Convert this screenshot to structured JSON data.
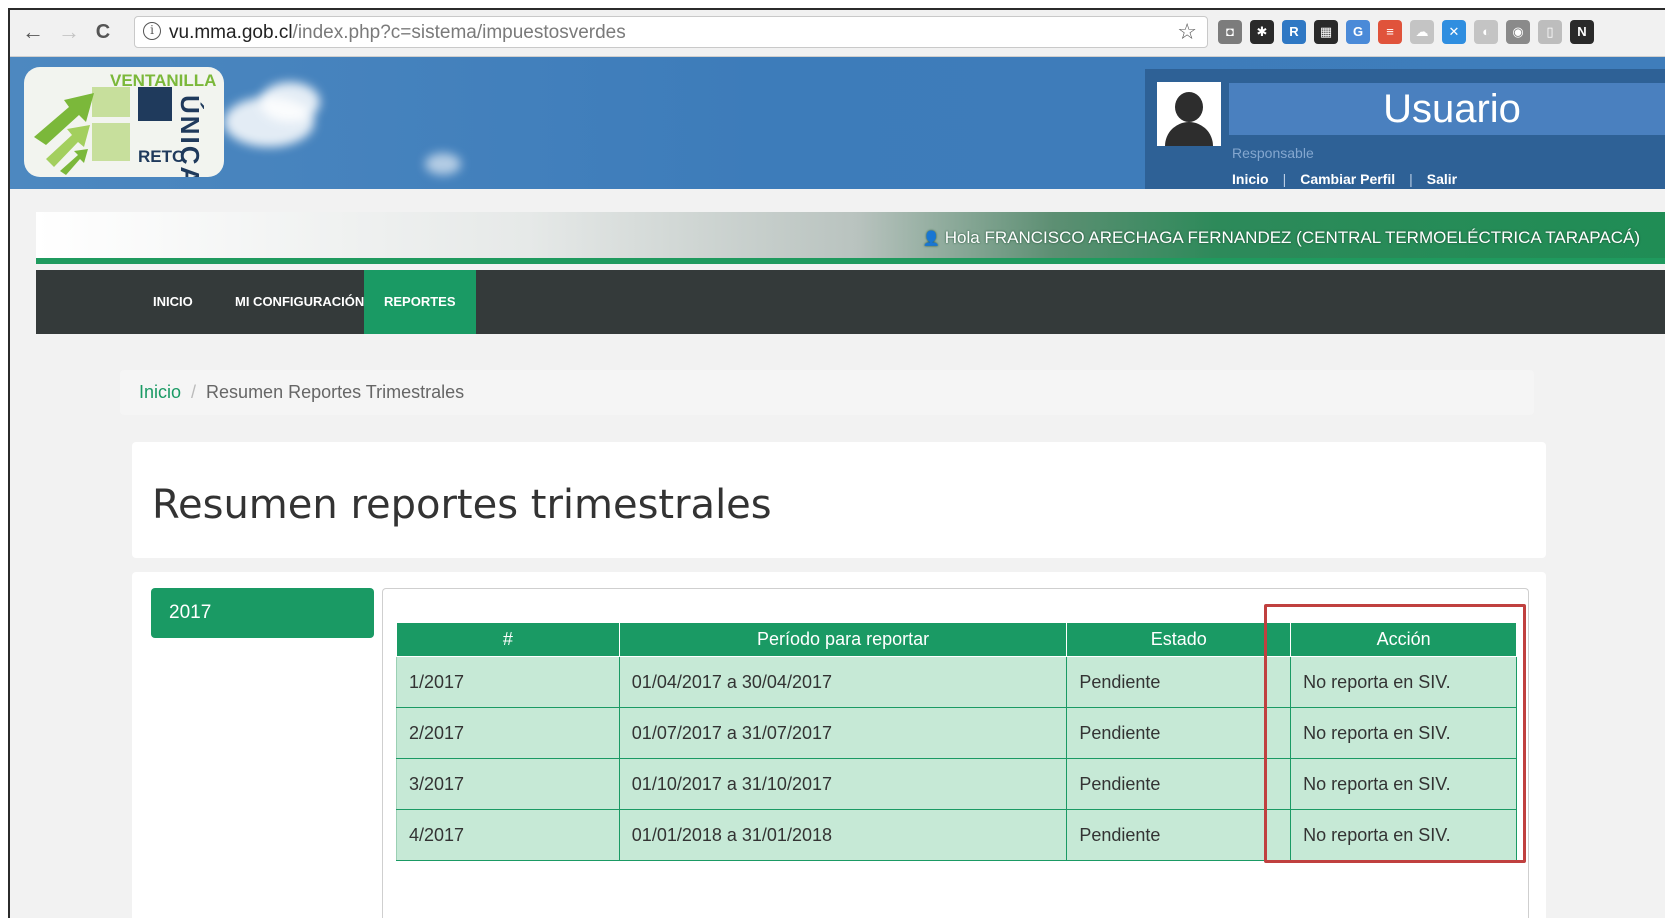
{
  "browser": {
    "url_domain": "vu.mma.gob.cl",
    "url_path": "/index.php?c=sistema/impuestosverdes",
    "back_glyph": "←",
    "forward_glyph": "→",
    "reload_glyph": "C",
    "info_glyph": "i",
    "star_glyph": "☆",
    "extensions": [
      {
        "icon": "camera-icon",
        "glyph": "◘",
        "color": "#7c7c7c"
      },
      {
        "icon": "gear-icon",
        "glyph": "✱",
        "color": "#2a2a2a"
      },
      {
        "icon": "rt-extension-icon",
        "glyph": "R",
        "color": "#2f78c4"
      },
      {
        "icon": "film-icon",
        "glyph": "▦",
        "color": "#2a2a2a"
      },
      {
        "icon": "translate-icon",
        "glyph": "G",
        "color": "#4a8ad8"
      },
      {
        "icon": "stack-extension-icon",
        "glyph": "≡",
        "color": "#e0533b"
      },
      {
        "icon": "cloud-icon",
        "glyph": "☁",
        "color": "#c4c4c4"
      },
      {
        "icon": "dropbox-icon",
        "glyph": "✕",
        "color": "#2f8ee0"
      },
      {
        "icon": "ghost-icon",
        "glyph": "◐",
        "color": "#c4c4c4"
      },
      {
        "icon": "chrome-extension-icon",
        "glyph": "◉",
        "color": "#8a8a8a"
      },
      {
        "icon": "reader-icon",
        "glyph": "▯",
        "color": "#bdbdbd"
      },
      {
        "icon": "notion-icon",
        "glyph": "N",
        "color": "#2a2a2a"
      }
    ]
  },
  "header": {
    "logo": {
      "line1": "VENTANILLA",
      "line2": "ÚNICA",
      "line3": "RETC"
    },
    "user": {
      "title": "Usuario",
      "role": "Responsable",
      "links": [
        "Inicio",
        "Cambiar Perfil",
        "Salir"
      ],
      "separator": "|"
    }
  },
  "greeting": {
    "icon_glyph": "👤",
    "text": "Hola FRANCISCO ARECHAGA FERNANDEZ (CENTRAL TERMOELÉCTRICA TARAPACÁ)"
  },
  "nav": {
    "items": [
      {
        "label": "INICIO",
        "active": false
      },
      {
        "label": "MI CONFIGURACIÓN",
        "active": false
      },
      {
        "label": "REPORTES",
        "active": true
      }
    ]
  },
  "breadcrumb": {
    "home": "Inicio",
    "separator": "/",
    "current": "Resumen Reportes Trimestrales"
  },
  "page": {
    "title": "Resumen reportes trimestrales",
    "year_tab": "2017"
  },
  "table": {
    "headers": [
      "#",
      "Período para reportar",
      "Estado",
      "Acción"
    ],
    "rows": [
      [
        "1/2017",
        "01/04/2017 a 30/04/2017",
        "Pendiente",
        "No reporta en SIV."
      ],
      [
        "2/2017",
        "01/07/2017 a 31/07/2017",
        "Pendiente",
        "No reporta en SIV."
      ],
      [
        "3/2017",
        "01/10/2017 a 31/10/2017",
        "Pendiente",
        "No reporta en SIV."
      ],
      [
        "4/2017",
        "01/01/2018 a 31/01/2018",
        "Pendiente",
        "No reporta en SIV."
      ]
    ]
  },
  "colors": {
    "accent_green": "#1a9a64",
    "row_green": "#c6e9d6",
    "header_blue": "#3d7cba",
    "highlight_red": "#c0403f"
  }
}
